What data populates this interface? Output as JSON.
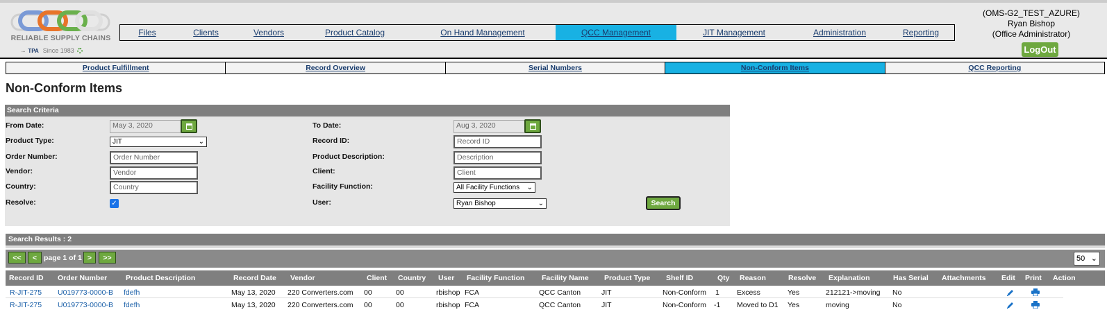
{
  "header": {
    "logo": {
      "brand": "RELIABLE SUPPLY CHAINS",
      "tpa": "TPA",
      "since": "Since 1983",
      "chain_colors": [
        "#7a9ad6",
        "#e8742a",
        "#6ab04c"
      ]
    },
    "main_nav": [
      {
        "label": "Files"
      },
      {
        "label": "Clients"
      },
      {
        "label": "Vendors"
      },
      {
        "label": "Product Catalog"
      },
      {
        "label": "On Hand Management"
      },
      {
        "label": "QCC Management",
        "active": true
      },
      {
        "label": "JIT Management"
      },
      {
        "label": "Administration"
      },
      {
        "label": "Reporting"
      }
    ],
    "user": {
      "tenant": "(OMS-G2_TEST_AZURE)",
      "name": "Ryan Bishop",
      "role": "(Office Administrator)"
    },
    "logout_label": "LogOut"
  },
  "sub_nav": [
    {
      "label": "Product Fulfillment"
    },
    {
      "label": "Record Overview"
    },
    {
      "label": "Serial Numbers"
    },
    {
      "label": "Non-Conform Items",
      "active": true
    },
    {
      "label": "QCC Reporting"
    }
  ],
  "page_title": "Non-Conform Items",
  "search": {
    "heading": "Search Criteria",
    "from_date": {
      "label": "From Date:",
      "value": "May 3, 2020"
    },
    "to_date": {
      "label": "To Date:",
      "value": "Aug 3, 2020"
    },
    "product_type": {
      "label": "Product Type:",
      "value": "JIT"
    },
    "record_id": {
      "label": "Record ID:",
      "placeholder": "Record ID"
    },
    "order_number": {
      "label": "Order Number:",
      "placeholder": "Order Number"
    },
    "product_description": {
      "label": "Product Description:",
      "placeholder": "Description"
    },
    "vendor": {
      "label": "Vendor:",
      "placeholder": "Vendor"
    },
    "client": {
      "label": "Client:",
      "placeholder": "Client"
    },
    "country": {
      "label": "Country:",
      "placeholder": "Country"
    },
    "facility_function": {
      "label": "Facility Function:",
      "value": "All Facility Functions"
    },
    "resolve": {
      "label": "Resolve:",
      "checked": true
    },
    "user": {
      "label": "User:",
      "value": "Ryan Bishop"
    },
    "search_button": "Search"
  },
  "results": {
    "summary": "Search Results : 2",
    "pager": {
      "first": "<<",
      "prev": "<",
      "page_text": "page 1 of 1",
      "next": ">",
      "last": ">>",
      "per_page": "50"
    },
    "columns": [
      "Record ID",
      "Order Number",
      "Product Description",
      "Record Date",
      "Vendor",
      "Client",
      "Country",
      "User",
      "Facility Function",
      "Facility Name",
      "Product Type",
      "Shelf ID",
      "Qty",
      "Reason",
      "Resolve",
      "Explanation",
      "Has Serial",
      "Attachments",
      "Edit",
      "Print",
      "Action"
    ],
    "rows": [
      {
        "record_id": "R-JIT-275",
        "order_number": "U019773-0000-B",
        "product_description": "fdefh",
        "record_date": "May 13, 2020",
        "vendor": "220 Converters.com",
        "client": "00",
        "country": "00",
        "user": "rbishop",
        "facility_function": "FCA",
        "facility_name": "QCC Canton",
        "product_type": "JIT",
        "shelf_id": "Non-Conform",
        "qty": "1",
        "reason": "Excess",
        "resolve": "Yes",
        "explanation": "212121->moving",
        "has_serial": "No",
        "attachments": ""
      },
      {
        "record_id": "R-JIT-275",
        "order_number": "U019773-0000-B",
        "product_description": "fdefh",
        "record_date": "May 13, 2020",
        "vendor": "220 Converters.com",
        "client": "00",
        "country": "00",
        "user": "rbishop",
        "facility_function": "FCA",
        "facility_name": "QCC Canton",
        "product_type": "JIT",
        "shelf_id": "Non-Conform",
        "qty": "-1",
        "reason": "Moved to D1",
        "resolve": "Yes",
        "explanation": "moving",
        "has_serial": "No",
        "attachments": ""
      }
    ]
  },
  "colors": {
    "accent_blue": "#18b1e3",
    "green_button": "#6ea83f",
    "header_gray": "#7f7f7f",
    "link": "#1a5fa8"
  }
}
